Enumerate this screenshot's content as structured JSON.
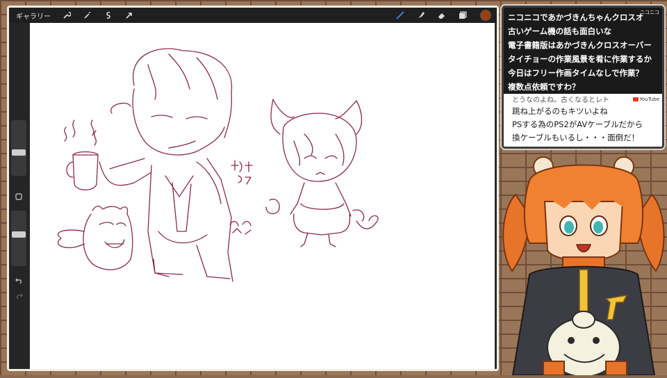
{
  "toolbar": {
    "gallery_label": "ギャラリー",
    "left_icons": [
      "wrench-icon",
      "magic-wand-icon",
      "selection-icon",
      "transform-arrow-icon"
    ],
    "right_icons": [
      "brush-icon",
      "smudge-icon",
      "eraser-icon",
      "layers-icon"
    ],
    "current_color": "#9a3f10"
  },
  "sidebar": {
    "undo_icon": "undo-icon",
    "redo_icon": "redo-icon",
    "modify_icon": "square-icon"
  },
  "canvas": {
    "handwriting_1": "ネクタイ",
    "handwriting_2": "ミミ"
  },
  "chat": {
    "lines": [
      "ニコニコであかづきんちゃんクロスオ",
      "古いゲーム機の話も面白いな",
      "電子書籍版はあかづきんクロスオーバー",
      "タイチョーの作業風景を肴に作業するか",
      "今日はフリー作画タイムなしで作業？",
      "複数点依頼ですわ？"
    ],
    "partial_line": "とうなのよね。古くなるとレト",
    "bottom_lines": [
      "跳ね上がるのもキツいよね",
      "PSする為のPS2がAVケーブルだから",
      "換ケーブルもいるし・・・面倒だ！"
    ],
    "nico_badge": "ニコニコ",
    "yt_badge": "YouTube"
  }
}
